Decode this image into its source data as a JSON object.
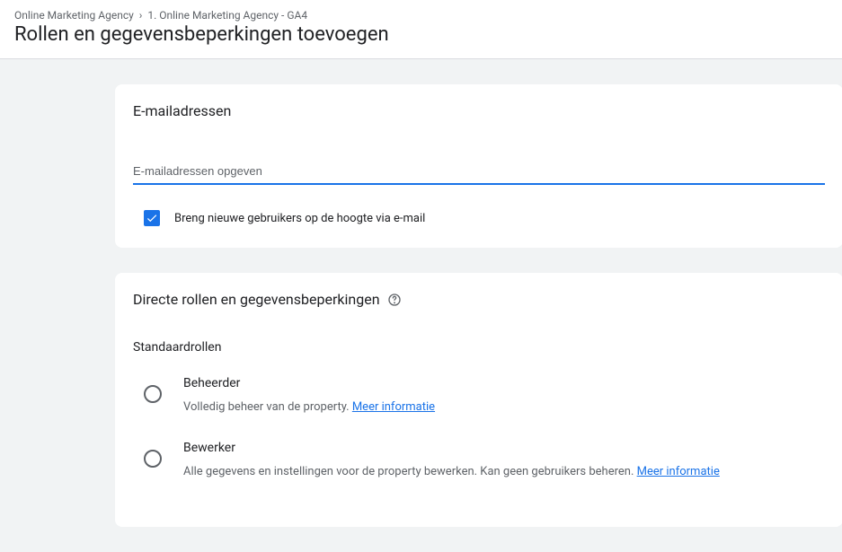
{
  "breadcrumb": {
    "item1": "Online Marketing Agency",
    "item2": "1. Online Marketing Agency - GA4"
  },
  "page_title": "Rollen en gegevensbeperkingen toevoegen",
  "email_card": {
    "title": "E-mailadressen",
    "placeholder": "E-mailadressen opgeven",
    "checkbox_label": "Breng nieuwe gebruikers op de hoogte via e-mail"
  },
  "roles_card": {
    "title": "Directe rollen en gegevensbeperkingen",
    "subsection": "Standaardrollen",
    "roles": [
      {
        "name": "Beheerder",
        "desc_prefix": "Volledig beheer van de property. ",
        "link": "Meer informatie"
      },
      {
        "name": "Bewerker",
        "desc_prefix": "Alle gegevens en instellingen voor de property bewerken. Kan geen gebruikers beheren. ",
        "link": "Meer informatie"
      }
    ]
  }
}
